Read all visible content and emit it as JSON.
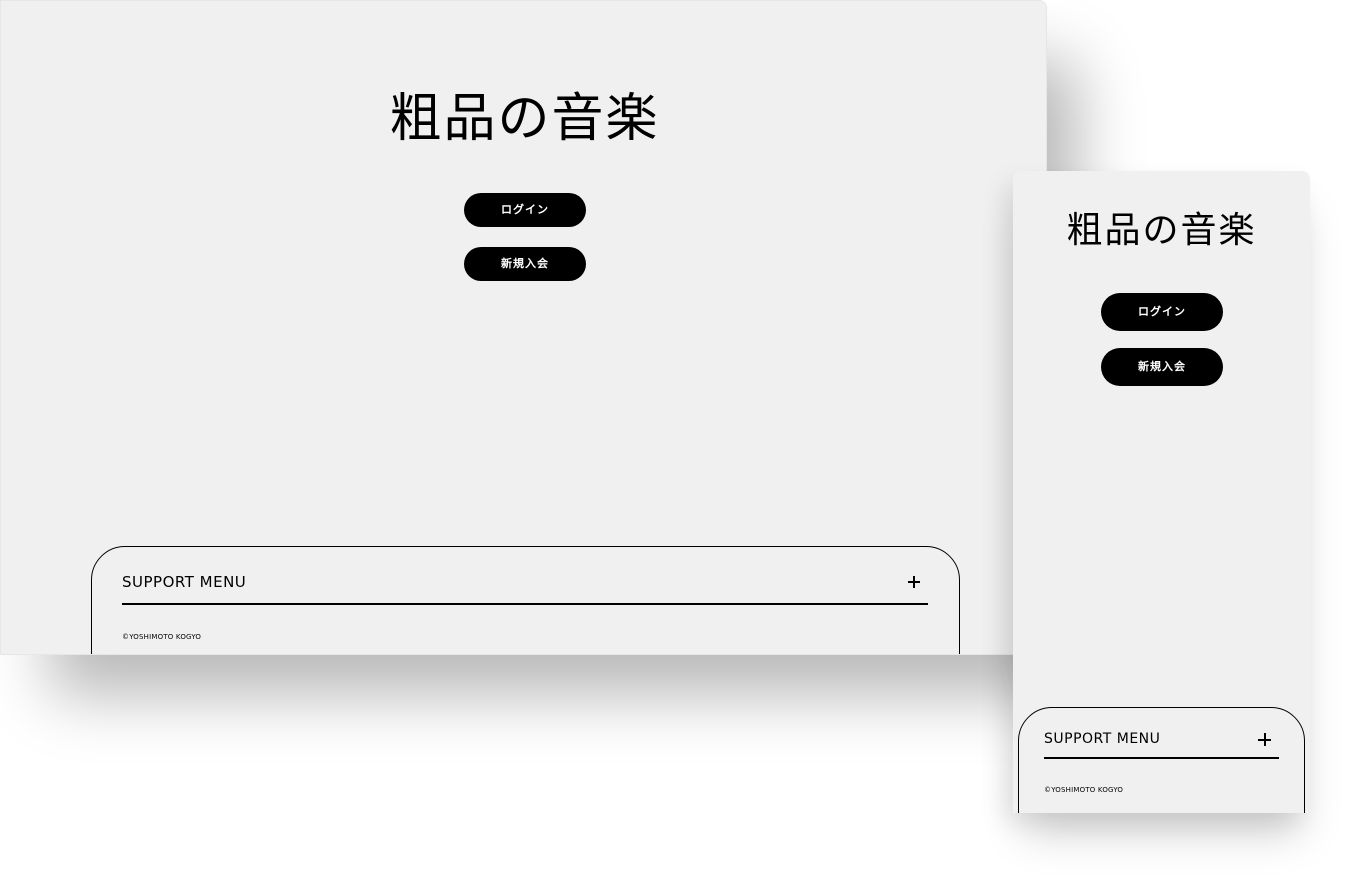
{
  "desktop": {
    "title": "粗品の音楽",
    "login_label": "ログイン",
    "signup_label": "新規入会",
    "support_menu_label": "SUPPORT MENU",
    "copyright": "©YOSHIMOTO KOGYO"
  },
  "mobile": {
    "title": "粗品の音楽",
    "login_label": "ログイン",
    "signup_label": "新規入会",
    "support_menu_label": "SUPPORT MENU",
    "copyright": "©YOSHIMOTO KOGYO"
  },
  "icons": {
    "expand": "plus-icon"
  },
  "colors": {
    "background": "#f0f0f0",
    "button": "#000000",
    "button_text": "#ffffff"
  }
}
